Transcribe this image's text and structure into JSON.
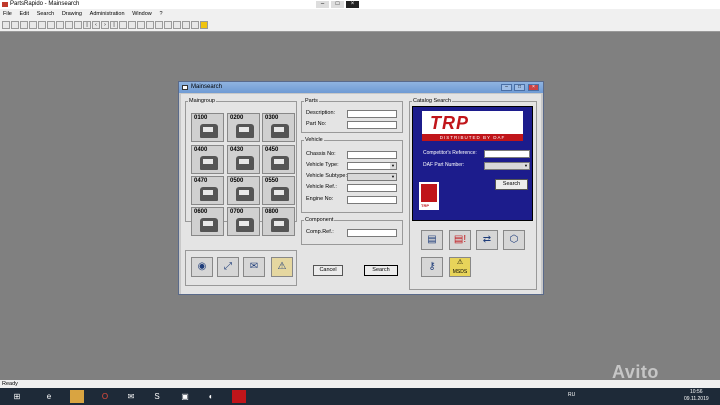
{
  "window": {
    "title": "PartsRapido - Mainsearch"
  },
  "menu": [
    "File",
    "Edit",
    "Search",
    "Drawing",
    "Administration",
    "Window",
    "?"
  ],
  "dialog": {
    "title": "Mainsearch",
    "maingroup_legend": "Maingroup",
    "groups": [
      "0100",
      "0200",
      "0300",
      "0400",
      "0430",
      "0450",
      "0470",
      "0500",
      "0550",
      "0600",
      "0700",
      "0800"
    ],
    "parts": {
      "legend": "Parts",
      "description_label": "Description:",
      "partno_label": "Part No:"
    },
    "vehicle": {
      "legend": "Vehicle",
      "chassis_label": "Chassis No:",
      "type_label": "Vehicle Type:",
      "subtype_label": "Vehicle Subtype:",
      "ref_label": "Vehicle Ref.:",
      "engine_label": "Engine No:"
    },
    "component": {
      "legend": "Component",
      "compref_label": "Comp.Ref.:"
    },
    "cancel_label": "Cancel",
    "search_label": "Search",
    "catalog": {
      "legend": "Catalog Search",
      "logo_text": "TRP",
      "logo_tagline": "DISTRIBUTED BY DAF",
      "competitor_label": "Competitor's Reference:",
      "daf_part_label": "DAF Part Number:",
      "search_label": "Search",
      "small_logo_text": "TRP",
      "msds_label": "MSDS"
    }
  },
  "status": {
    "text": "Ready"
  },
  "taskbar": {
    "lang": "RU",
    "time": "10:56",
    "date": "09.11.2019"
  },
  "watermark": {
    "text": "Avito"
  }
}
